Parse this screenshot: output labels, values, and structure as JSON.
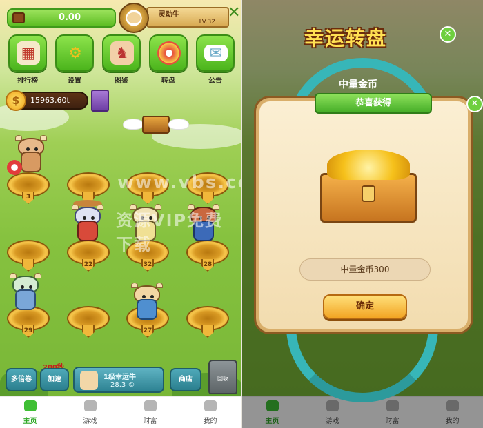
{
  "left": {
    "topbar": {
      "balance": "0.00"
    },
    "profile": {
      "name": "灵动牛",
      "level": "LV.32"
    },
    "menu": [
      {
        "label": "排行榜",
        "icon": "ranking-icon"
      },
      {
        "label": "设置",
        "icon": "gear-icon"
      },
      {
        "label": "图鉴",
        "icon": "collection-icon"
      },
      {
        "label": "转盘",
        "icon": "wheel-icon"
      },
      {
        "label": "公告",
        "icon": "mail-icon"
      }
    ],
    "coins": "15963.60t",
    "slots": [
      {
        "num": "3"
      },
      {
        "num": ""
      },
      {
        "num": ""
      },
      {
        "num": ""
      },
      {
        "num": ""
      },
      {
        "num": "22"
      },
      {
        "num": "32"
      },
      {
        "num": "28"
      },
      {
        "num": "29"
      },
      {
        "num": ""
      },
      {
        "num": "27"
      },
      {
        "num": ""
      }
    ],
    "controls": {
      "timer": "200秒",
      "btn1": "多倍卷",
      "btn2": "加速",
      "panel_line1": "1级幸运牛",
      "panel_line2": "28.3 ©",
      "shop": "商店",
      "trash": "回收"
    },
    "tabs": [
      {
        "label": "主页",
        "active": true
      },
      {
        "label": "游戏",
        "active": false
      },
      {
        "label": "财富",
        "active": false
      },
      {
        "label": "我的",
        "active": false
      }
    ]
  },
  "right": {
    "wheel_title": "幸运转盘",
    "wheel_label": "中量金币",
    "ribbon": "恭喜获得",
    "result": "中量金币300",
    "confirm": "确定",
    "tabs": [
      {
        "label": "主页"
      },
      {
        "label": "游戏"
      },
      {
        "label": "财富"
      },
      {
        "label": "我的"
      }
    ]
  },
  "watermark": [
    "www.vbs.com",
    "资源VIP免费下载"
  ],
  "colors": {
    "accent_green": "#4bb41c",
    "gold": "#f2a524",
    "teal": "#37b6b8"
  }
}
